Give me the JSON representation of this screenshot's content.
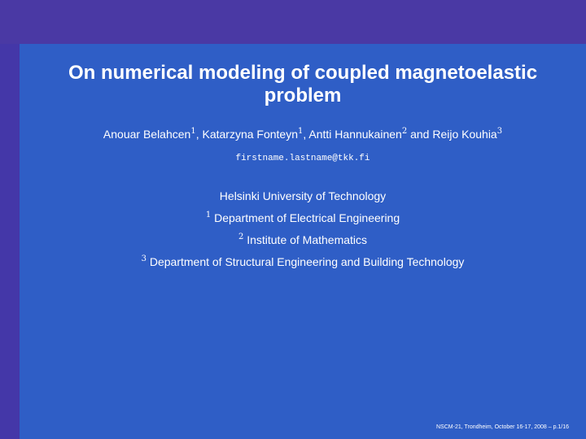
{
  "slide": {
    "title_line1": "On numerical modeling of coupled magnetoelastic",
    "title_line2": "problem",
    "authors": [
      {
        "name": "Anouar Belahcen",
        "mark": "1"
      },
      {
        "name": "Katarzyna Fonteyn",
        "mark": "1"
      },
      {
        "name": "Antti Hannukainen",
        "mark": "2"
      },
      {
        "name": "Reijo Kouhia",
        "mark": "3"
      }
    ],
    "author_sep_comma": ", ",
    "author_sep_and": " and ",
    "email": "firstname.lastname@tkk.fi",
    "university": "Helsinki University of Technology",
    "affiliations": [
      {
        "mark": "1",
        "text": "Department of Electrical Engineering"
      },
      {
        "mark": "2",
        "text": "Institute of Mathematics"
      },
      {
        "mark": "3",
        "text": "Department of Structural Engineering and Building Technology"
      }
    ],
    "footer": "NSCM-21, Trondheim, October 16-17, 2008 – p.1/16"
  },
  "colors": {
    "frame": "#3b3aa6",
    "top_band": "#4a39a4",
    "left_band": "#4437a8",
    "content_bg": "#2f5ec6",
    "text": "#ffffff"
  }
}
